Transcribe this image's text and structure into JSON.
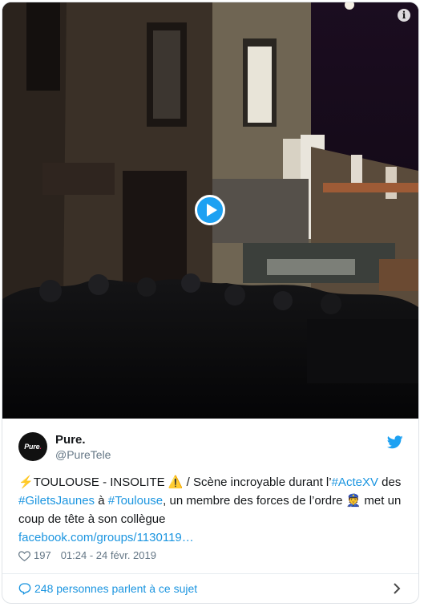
{
  "colors": {
    "accent": "#1b95e0",
    "play_button": "#1da1f2",
    "muted": "#657786"
  },
  "media": {
    "type": "video-thumbnail",
    "icons": {
      "info": "info-icon",
      "play": "play-icon"
    },
    "info_glyph": "i"
  },
  "author": {
    "avatar_text": "Pure",
    "avatar_dot": ".",
    "display_name": "Pure.",
    "handle": "@PureTele",
    "brand_icon": "twitter-bird-icon"
  },
  "tweet": {
    "lead_emoji": "⚡",
    "headline": "TOULOUSE - INSOLITE",
    "warning_emoji": "⚠️",
    "text_1": " / Scène incroyable durant l’",
    "hashtag_1": "#ActeXV",
    "text_2": " des ",
    "hashtag_2": "#GiletsJaunes",
    "text_3": " à ",
    "hashtag_3": "#Toulouse",
    "text_4": ", un membre des forces de l’ordre ",
    "police_emoji": "👮",
    "text_5": " met un coup de tête à son collègue",
    "link": "facebook.com/groups/1130119…"
  },
  "meta": {
    "likes": "197",
    "timestamp": "01:24 - 24 févr. 2019"
  },
  "footer": {
    "conversation": "248 personnes parlent à ce sujet"
  }
}
